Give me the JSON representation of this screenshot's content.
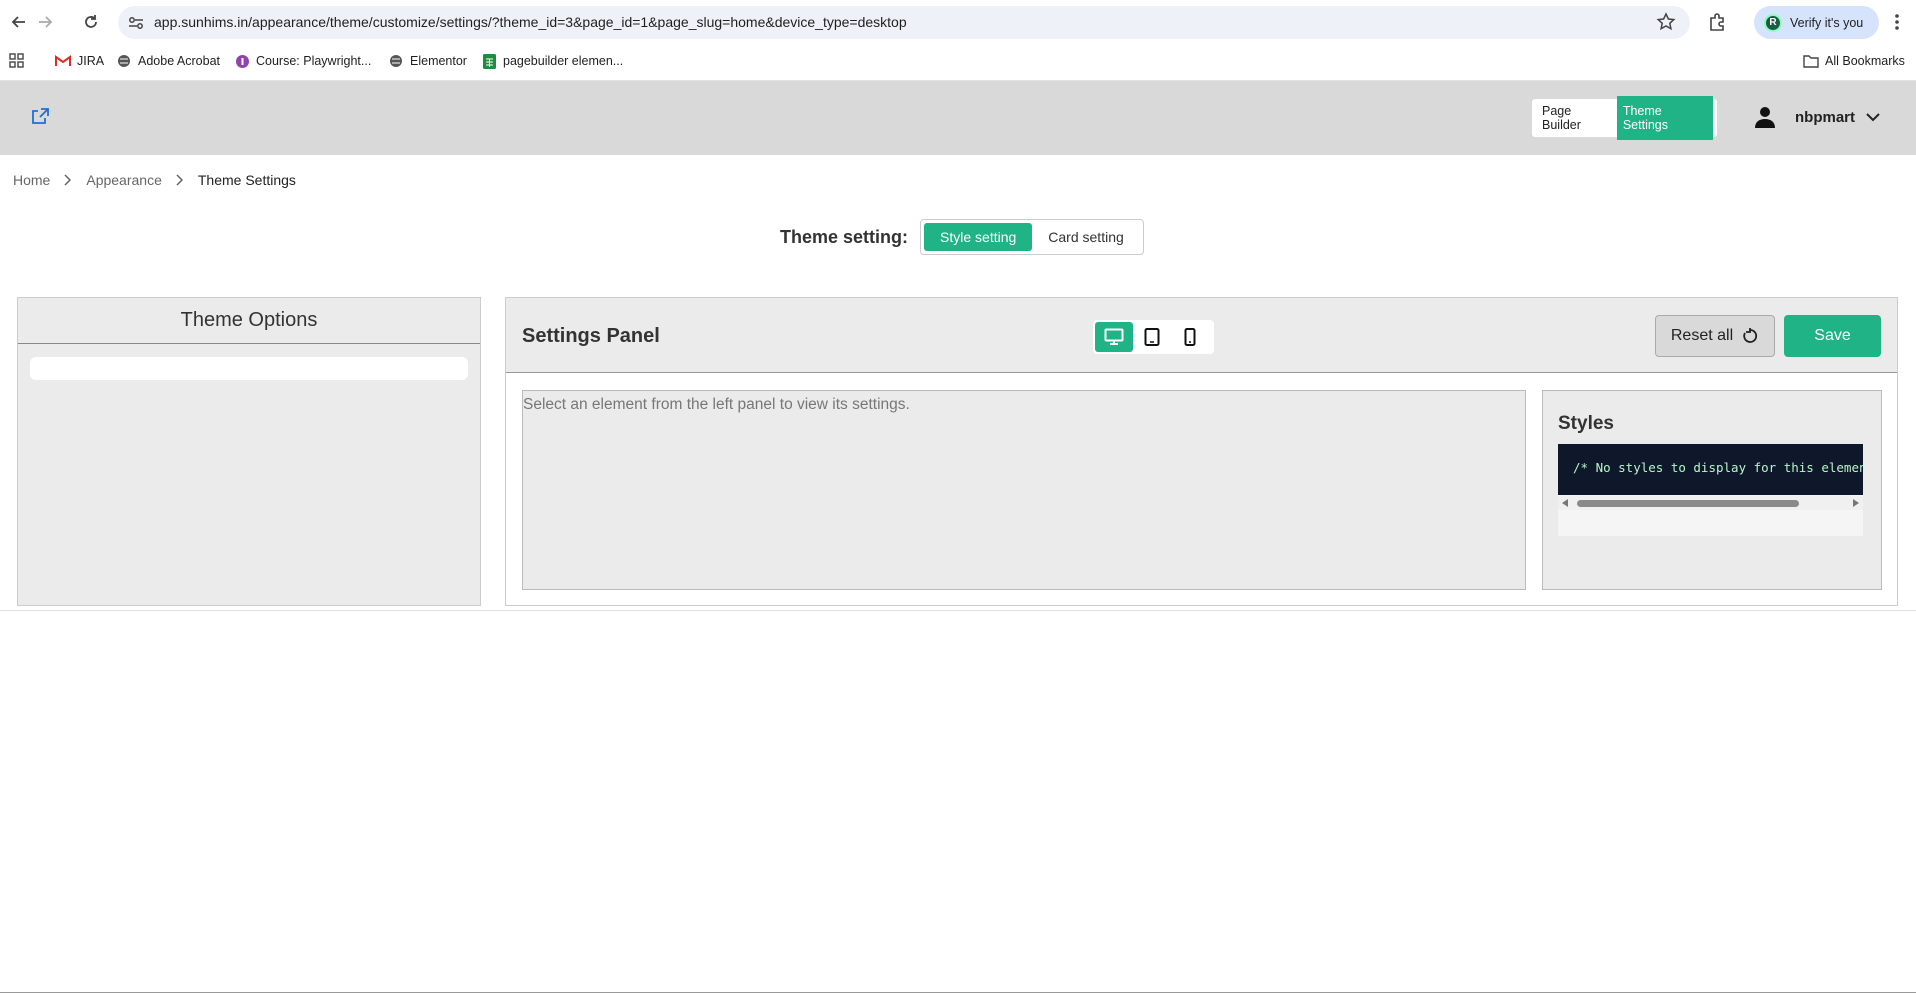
{
  "browser": {
    "url": "app.sunhims.in/appearance/theme/customize/settings/?theme_id=3&page_id=1&page_slug=home&device_type=desktop",
    "profile_button": "Verify it's you",
    "profile_initial": "R",
    "bookmarks": [
      {
        "label": "JIRA",
        "icon": "gmail-icon"
      },
      {
        "label": "Adobe Acrobat",
        "icon": "globe-icon"
      },
      {
        "label": "Course: Playwright...",
        "icon": "course-icon"
      },
      {
        "label": "Elementor",
        "icon": "globe-icon"
      },
      {
        "label": "pagebuilder elemen...",
        "icon": "sheets-icon"
      }
    ],
    "all_bookmarks": "All Bookmarks"
  },
  "header": {
    "modes": [
      "Page Builder",
      "Theme Settings"
    ],
    "active_mode": "Theme Settings",
    "username": "nbpmart",
    "accent": "#1fb386"
  },
  "breadcrumb": [
    "Home",
    "Appearance",
    "Theme Settings"
  ],
  "theme_setting": {
    "label": "Theme setting:",
    "options": [
      "Style setting",
      "Card setting"
    ],
    "active": "Style setting"
  },
  "left_panel": {
    "title": "Theme Options"
  },
  "settings_panel": {
    "title": "Settings Panel",
    "devices": [
      "desktop-icon",
      "tablet-icon",
      "mobile-icon"
    ],
    "active_device": "desktop",
    "reset_label": "Reset all",
    "save_label": "Save",
    "hint": "Select an element from the left panel to view its settings.",
    "styles_title": "Styles",
    "styles_code": "/* No styles to display for this element */"
  }
}
